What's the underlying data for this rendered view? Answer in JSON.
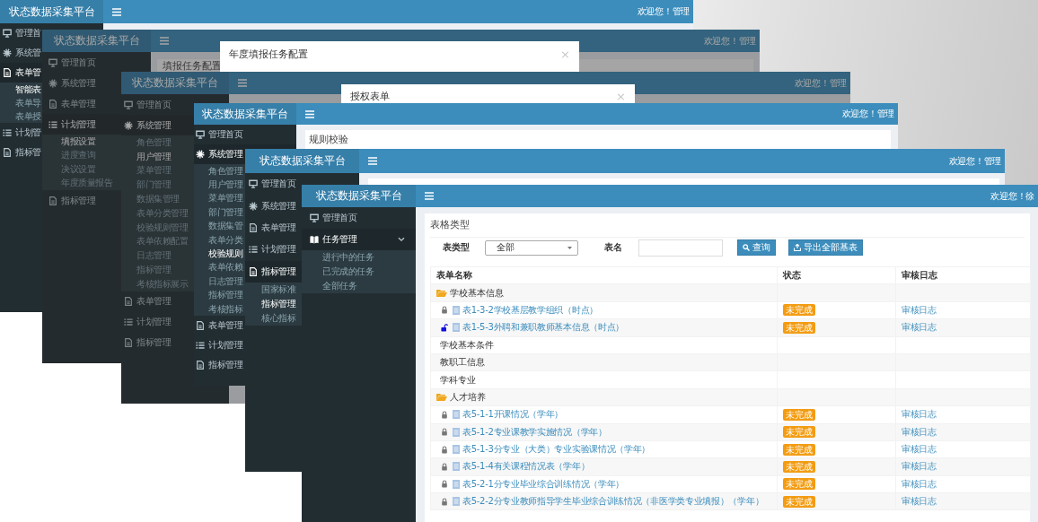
{
  "windows": [
    {
      "brand": "状态数据采集平台",
      "welcome": "欢迎您！管理",
      "dimmed": false,
      "sidebar": [
        {
          "label": "管理首",
          "kind": "home",
          "selected": false
        },
        {
          "label": "系统管",
          "kind": "system",
          "selected": false
        },
        {
          "label": "表单管",
          "kind": "form",
          "selected": true,
          "children": [
            {
              "label": "智能表",
              "selected": true
            },
            {
              "label": "表单导",
              "selected": false
            },
            {
              "label": "表单授",
              "selected": false
            }
          ]
        },
        {
          "label": "计划管",
          "kind": "plan",
          "selected": false
        },
        {
          "label": "指标管",
          "kind": "indicator",
          "selected": false
        }
      ]
    },
    {
      "brand": "状态数据采集平台",
      "welcome": "欢迎您！管理",
      "dimmed": true,
      "sidebar": [
        {
          "label": "管理首页",
          "kind": "home",
          "selected": false
        },
        {
          "label": "系统管理",
          "kind": "system",
          "selected": false
        },
        {
          "label": "表单管理",
          "kind": "form",
          "selected": false
        },
        {
          "label": "计划管理",
          "kind": "plan",
          "selected": true,
          "children": [
            {
              "label": "填报设置",
              "selected": true
            },
            {
              "label": "进度查询",
              "selected": false
            },
            {
              "label": "决议设置",
              "selected": false
            },
            {
              "label": "年度质量报告",
              "selected": false
            }
          ]
        },
        {
          "label": "指标管理",
          "kind": "indicator",
          "selected": false
        }
      ],
      "content": {
        "kind": "card",
        "card_title": "填报任务配置"
      },
      "dialog": {
        "title": "年度填报任务配置",
        "close": "×"
      }
    },
    {
      "brand": "状态数据采集平台",
      "welcome": "欢迎您！管理",
      "dimmed": true,
      "sidebar": [
        {
          "label": "管理首页",
          "kind": "home",
          "selected": false
        },
        {
          "label": "系统管理",
          "kind": "system",
          "selected": true,
          "children": [
            {
              "label": "角色管理",
              "selected": false
            },
            {
              "label": "用户管理",
              "selected": true
            },
            {
              "label": "菜单管理",
              "selected": false
            },
            {
              "label": "部门管理",
              "selected": false
            },
            {
              "label": "数据集管理",
              "selected": false
            },
            {
              "label": "表单分类管理",
              "selected": false
            },
            {
              "label": "校验规则管理",
              "selected": false
            },
            {
              "label": "表单依赖配置",
              "selected": false
            },
            {
              "label": "日志管理",
              "selected": false
            },
            {
              "label": "指标管理",
              "selected": false
            },
            {
              "label": "考核指标展示",
              "selected": false
            }
          ]
        },
        {
          "label": "表单管理",
          "kind": "form",
          "selected": false
        },
        {
          "label": "计划管理",
          "kind": "plan",
          "selected": false
        },
        {
          "label": "指标管理",
          "kind": "indicator",
          "selected": false
        }
      ],
      "dialog": {
        "title": "授权表单",
        "close": "×"
      }
    },
    {
      "brand": "状态数据采集平台",
      "welcome": "欢迎您！管理",
      "dimmed": false,
      "sidebar": [
        {
          "label": "管理首页",
          "kind": "home",
          "selected": false
        },
        {
          "label": "系统管理",
          "kind": "system",
          "selected": true,
          "children": [
            {
              "label": "角色管理",
              "selected": false
            },
            {
              "label": "用户管理",
              "selected": false
            },
            {
              "label": "菜单管理",
              "selected": false
            },
            {
              "label": "部门管理",
              "selected": false
            },
            {
              "label": "数据集管",
              "selected": false
            },
            {
              "label": "表单分类",
              "selected": false
            },
            {
              "label": "校验规则",
              "selected": true
            },
            {
              "label": "表单依赖",
              "selected": false
            },
            {
              "label": "日志管理",
              "selected": false
            },
            {
              "label": "指标管理",
              "selected": false
            },
            {
              "label": "考核指标",
              "selected": false
            }
          ]
        },
        {
          "label": "表单管理",
          "kind": "form",
          "selected": false
        },
        {
          "label": "计划管理",
          "kind": "plan",
          "selected": false
        },
        {
          "label": "指标管理",
          "kind": "indicator",
          "selected": false
        }
      ],
      "content": {
        "kind": "card",
        "card_title": "规则校验"
      }
    },
    {
      "brand": "状态数据采集平台",
      "welcome": "欢迎您！管理",
      "dimmed": false,
      "sidebar": [
        {
          "label": "管理首页",
          "kind": "home",
          "selected": false
        },
        {
          "label": "系统管理",
          "kind": "system",
          "selected": false
        },
        {
          "label": "表单管理",
          "kind": "form",
          "selected": false
        },
        {
          "label": "计划管理",
          "kind": "plan",
          "selected": false
        },
        {
          "label": "指标管理",
          "kind": "indicator",
          "selected": true,
          "children": [
            {
              "label": "国家标准",
              "selected": false
            },
            {
              "label": "指标管理",
              "selected": true
            },
            {
              "label": "核心指标",
              "selected": false
            }
          ]
        }
      ],
      "content": {
        "kind": "card"
      }
    },
    {
      "brand": "状态数据采集平台",
      "welcome": "欢迎您！徐",
      "dimmed": false,
      "sidebar": [
        {
          "label": "管理首页",
          "kind": "home",
          "selected": false,
          "expanded": false
        },
        {
          "label": "任务管理",
          "kind": "task",
          "selected": true,
          "expanded": true,
          "children": [
            {
              "label": "进行中的任务",
              "selected": false
            },
            {
              "label": "已完成的任务",
              "selected": false
            },
            {
              "label": "全部任务",
              "selected": false
            }
          ]
        }
      ],
      "content": {
        "kind": "card",
        "card_title": "表格类型",
        "filters": {
          "type_label": "表类型",
          "type_value": "全部",
          "name_label": "表名",
          "buttons": [
            {
              "label": "查询",
              "kind": "search"
            },
            {
              "label": "导出全部基表",
              "kind": "export"
            }
          ]
        },
        "table": {
          "columns": [
            "表单名称",
            "状态",
            "审核日志"
          ],
          "rows": [
            {
              "kind": "group",
              "name": "学校基本信息"
            },
            {
              "kind": "form",
              "name": "表1-3-2学校基层教学组织（时点）",
              "locked": true,
              "status": "未完成",
              "log": "审核日志"
            },
            {
              "kind": "form",
              "name": "表1-5-3外聘和兼职教师基本信息（时点）",
              "locked": false,
              "status": "未完成",
              "log": "审核日志"
            },
            {
              "kind": "category",
              "name": "学校基本条件"
            },
            {
              "kind": "category",
              "name": "教职工信息"
            },
            {
              "kind": "category",
              "name": "学科专业"
            },
            {
              "kind": "group",
              "name": "人才培养"
            },
            {
              "kind": "form",
              "name": "表5-1-1开课情况（学年）",
              "locked": true,
              "status": "未完成",
              "log": "审核日志"
            },
            {
              "kind": "form",
              "name": "表5-1-2专业课教学实施情况（学年）",
              "locked": true,
              "status": "未完成",
              "log": "审核日志"
            },
            {
              "kind": "form",
              "name": "表5-1-3分专业（大类）专业实验课情况（学年）",
              "locked": true,
              "status": "未完成",
              "log": "审核日志"
            },
            {
              "kind": "form",
              "name": "表5-1-4有关课程情况表（学年）",
              "locked": true,
              "status": "未完成",
              "log": "审核日志"
            },
            {
              "kind": "form",
              "name": "表5-2-1分专业毕业综合训练情况（学年）",
              "locked": true,
              "status": "未完成",
              "log": "审核日志"
            },
            {
              "kind": "form",
              "name": "表5-2-2分专业教师指导学生毕业综合训练情况（非医学类专业填报）（学年）",
              "locked": true,
              "status": "未完成",
              "log": "审核日志"
            }
          ]
        }
      }
    }
  ]
}
